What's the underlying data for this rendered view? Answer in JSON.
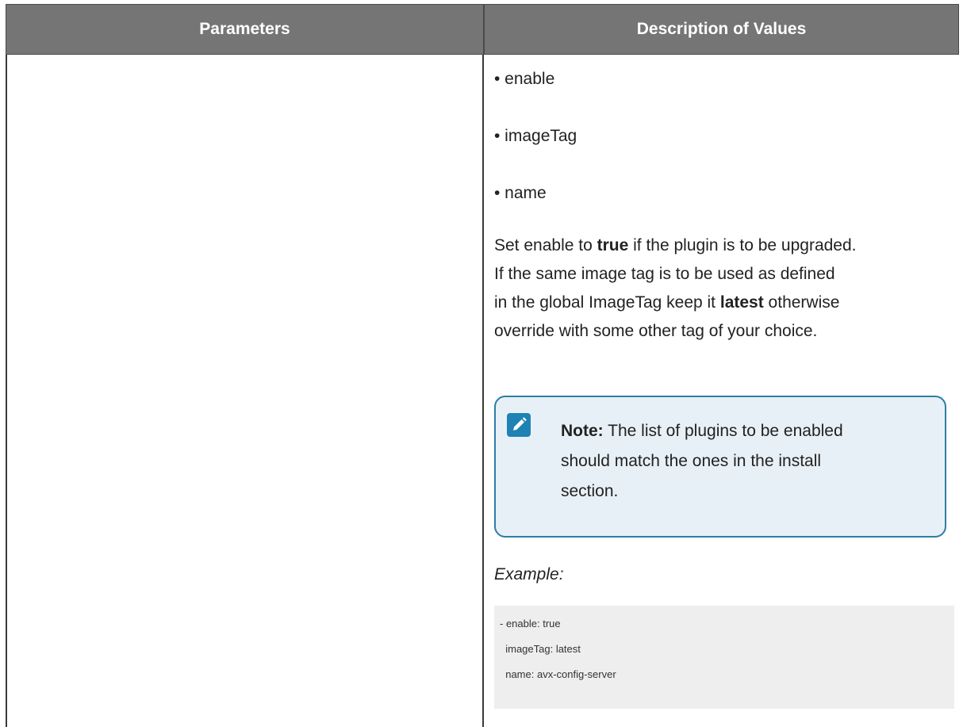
{
  "table": {
    "headers": {
      "parameters": "Parameters",
      "description": "Description of Values"
    },
    "bullets": [
      "• enable",
      "• imageTag",
      "• name"
    ],
    "paragraph": {
      "line1_a": "Set enable to ",
      "line1_b": "true",
      "line1_c": " if the plugin is to be upgraded.",
      "line2": "If the same image tag is to be used as defined",
      "line3_a": "in the global ImageTag keep it ",
      "line3_b": "latest",
      "line3_c": " otherwise",
      "line4": "override with some other tag of your choice."
    },
    "note": {
      "icon": "pencil-icon",
      "label": "Note:",
      "line1": " The list of plugins to be enabled",
      "line2": "should match the ones in the install",
      "line3": "section.",
      "accent": "#1e82b4",
      "background": "#e8f0f7"
    },
    "example_label": "Example:",
    "code_lines": [
      "- enable: true",
      "  imageTag: latest",
      "  name: avx-config-server"
    ]
  }
}
